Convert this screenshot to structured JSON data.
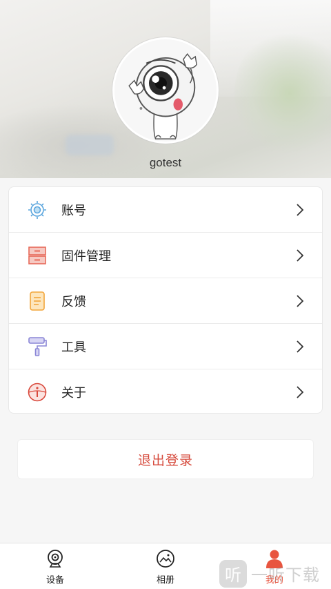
{
  "profile": {
    "username": "gotest"
  },
  "menu": {
    "items": [
      {
        "label": "账号",
        "icon": "account-gear-icon"
      },
      {
        "label": "固件管理",
        "icon": "firmware-cabinet-icon"
      },
      {
        "label": "反馈",
        "icon": "feedback-document-icon"
      },
      {
        "label": "工具",
        "icon": "tools-paint-roller-icon"
      },
      {
        "label": "关于",
        "icon": "about-info-icon"
      }
    ]
  },
  "logout": {
    "label": "退出登录"
  },
  "tabbar": {
    "items": [
      {
        "label": "设备",
        "icon": "camera-device-icon",
        "active": false
      },
      {
        "label": "相册",
        "icon": "album-icon",
        "active": false
      },
      {
        "label": "我的",
        "icon": "person-icon",
        "active": true
      }
    ]
  },
  "watermark": {
    "badge": "听",
    "text": "一听下载"
  },
  "colors": {
    "accent": "#e8553f",
    "logout_text": "#d64a3c",
    "account_icon": "#5aa5dd",
    "firmware_icon": "#e86a5a",
    "feedback_icon": "#f2a53a",
    "tools_icon": "#8a86d6",
    "about_icon": "#d9483b"
  }
}
